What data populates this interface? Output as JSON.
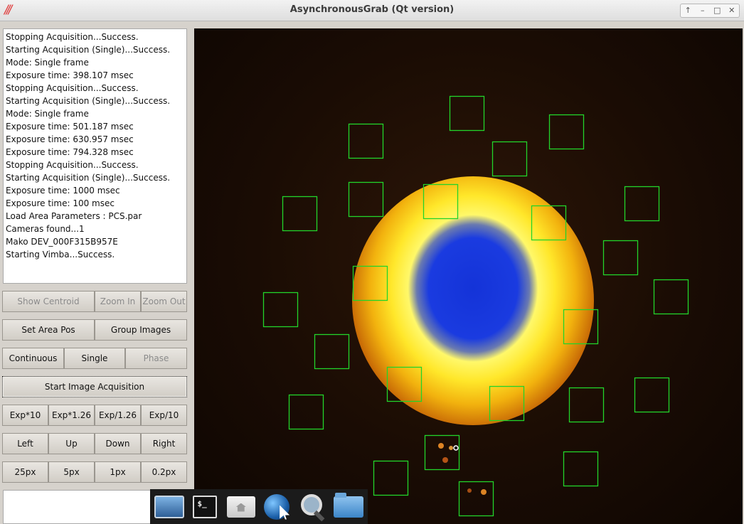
{
  "window": {
    "title": "AsynchronousGrab (Qt version)",
    "controls": [
      "↑",
      "–",
      "□",
      "✕"
    ]
  },
  "log": [
    "Stopping Acquisition...Success.",
    "Starting Acquisition (Single)...Success.",
    "Mode: Single frame",
    "Exposure time: 398.107 msec",
    "Stopping Acquisition...Success.",
    "Starting Acquisition (Single)...Success.",
    "Mode: Single frame",
    "Exposure time: 501.187 msec",
    "Exposure time: 630.957 msec",
    "Exposure time: 794.328 msec",
    "Stopping Acquisition...Success.",
    "Starting Acquisition (Single)...Success.",
    "Exposure time: 1000 msec",
    "Exposure time: 100 msec",
    "Load Area Parameters : PCS.par",
    "Cameras found...1",
    "Mako DEV_000F315B957E",
    "Starting Vimba...Success."
  ],
  "buttons": {
    "show_centroid": "Show Centroid",
    "zoom_in": "Zoom In",
    "zoom_out": "Zoom Out",
    "set_area_pos": "Set Area Pos",
    "group_images": "Group Images",
    "continuous": "Continuous",
    "single": "Single",
    "phase": "Phase",
    "start_acquisition": "Start Image Acquisition",
    "exp_x10": "Exp*10",
    "exp_x126": "Exp*1.26",
    "exp_div126": "Exp/1.26",
    "exp_div10": "Exp/10",
    "left": "Left",
    "up": "Up",
    "down": "Down",
    "right": "Right",
    "step_25": "25px",
    "step_5": "5px",
    "step_1": "1px",
    "step_02": "0.2px"
  },
  "colors": {
    "roi_box": "#22d42a",
    "beam_core": "#1433d8",
    "beam_ring": "#ffe72a"
  },
  "taskbar": [
    "monitor-icon",
    "terminal-icon",
    "home-folder-icon",
    "web-browser-icon",
    "search-icon",
    "file-manager-icon"
  ],
  "terminal_glyph": "$_"
}
